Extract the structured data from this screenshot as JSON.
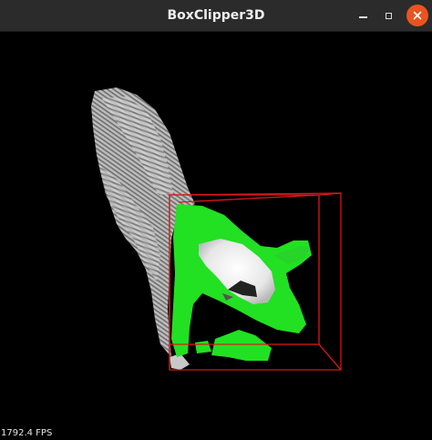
{
  "window": {
    "title": "BoxClipper3D",
    "buttons": [
      "minimize",
      "maximize",
      "close"
    ]
  },
  "viewport": {
    "fps_text": "1792.4 FPS",
    "background": "#000000",
    "colors": {
      "inside_box": "#1ee01e",
      "outside_box": "#cfcfcf",
      "clip_box": "#e01818",
      "close_button": "#e95420"
    }
  }
}
